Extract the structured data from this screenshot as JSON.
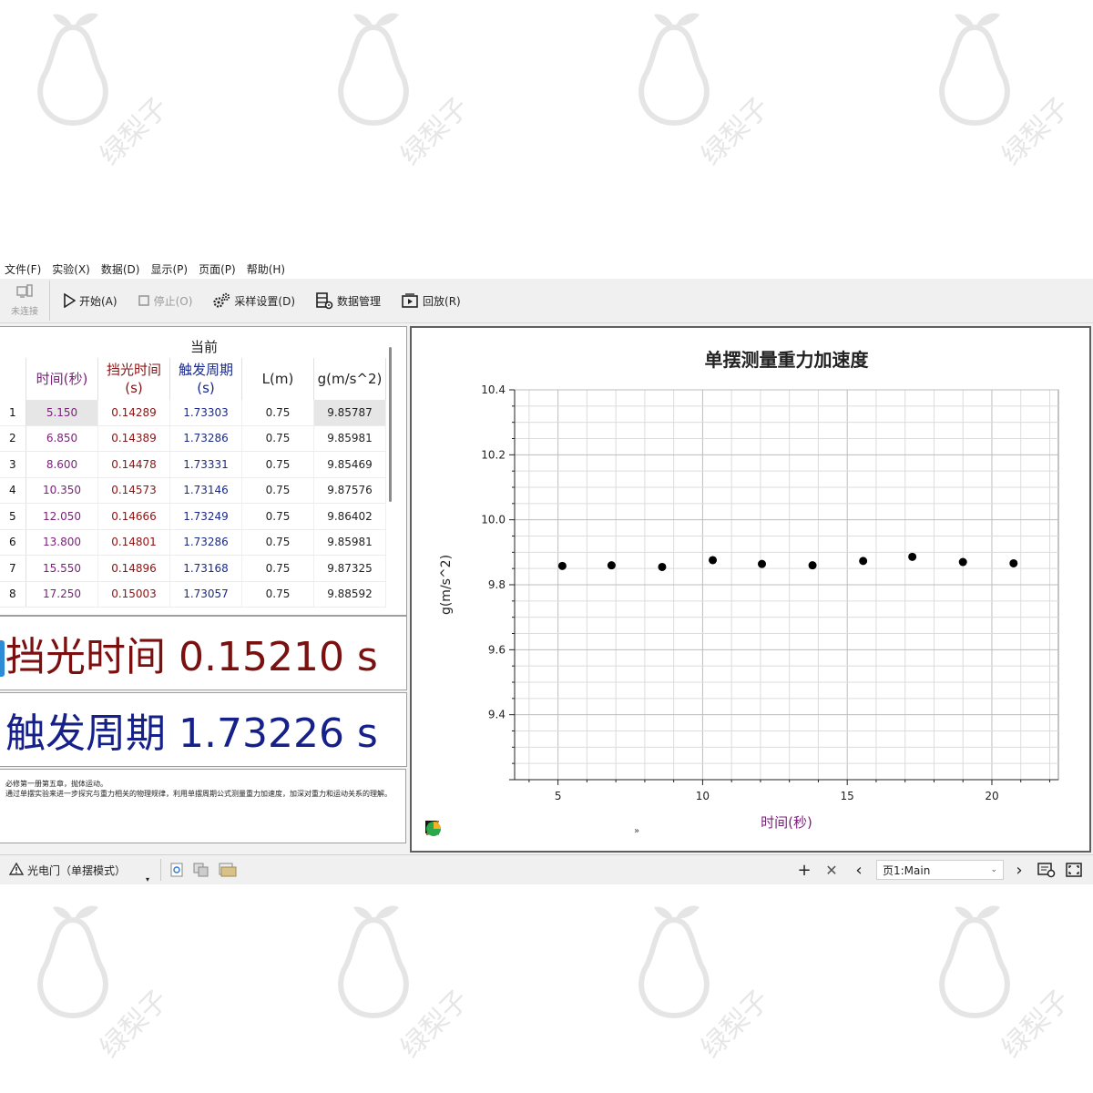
{
  "menu": [
    "文件(F)",
    "实验(X)",
    "数据(D)",
    "显示(P)",
    "页面(P)",
    "帮助(H)"
  ],
  "toolbar": {
    "connection_label": "未连接",
    "start_label": "开始(A)",
    "stop_label": "停止(O)",
    "sampling_label": "采样设置(D)",
    "data_mgmt_label": "数据管理",
    "playback_label": "回放(R)"
  },
  "table": {
    "group_header": "当前",
    "columns": [
      {
        "line1": "时间(秒)",
        "line2": ""
      },
      {
        "line1": "挡光时间",
        "line2": "(s)"
      },
      {
        "line1": "触发周期",
        "line2": "(s)"
      },
      {
        "line1": "L(m)",
        "line2": ""
      },
      {
        "line1": "g(m/s^2)",
        "line2": ""
      }
    ],
    "rows": [
      {
        "n": "1",
        "time": "5.150",
        "block": "0.14289",
        "period": "1.73303",
        "len": "0.75",
        "g": "9.85787"
      },
      {
        "n": "2",
        "time": "6.850",
        "block": "0.14389",
        "period": "1.73286",
        "len": "0.75",
        "g": "9.85981"
      },
      {
        "n": "3",
        "time": "8.600",
        "block": "0.14478",
        "period": "1.73331",
        "len": "0.75",
        "g": "9.85469"
      },
      {
        "n": "4",
        "time": "10.350",
        "block": "0.14573",
        "period": "1.73146",
        "len": "0.75",
        "g": "9.87576"
      },
      {
        "n": "5",
        "time": "12.050",
        "block": "0.14666",
        "period": "1.73249",
        "len": "0.75",
        "g": "9.86402"
      },
      {
        "n": "6",
        "time": "13.800",
        "block": "0.14801",
        "period": "1.73286",
        "len": "0.75",
        "g": "9.85981"
      },
      {
        "n": "7",
        "time": "15.550",
        "block": "0.14896",
        "period": "1.73168",
        "len": "0.75",
        "g": "9.87325"
      },
      {
        "n": "8",
        "time": "17.250",
        "block": "0.15003",
        "period": "1.73057",
        "len": "0.75",
        "g": "9.88592"
      }
    ]
  },
  "big_display_1": "挡光时间 0.15210 s",
  "big_display_2": "触发周期 1.73226 s",
  "note": {
    "line1": "必修第一册第五章，抛体运动。",
    "line2": "通过单摆实验来进一步探究与重力相关的物理规律，利用单摆周期公式测量重力加速度，加深对重力和运动关系的理解。"
  },
  "chart_data": {
    "type": "scatter",
    "title": "单摆测量重力加速度",
    "xlabel": "时间(秒)",
    "ylabel": "g(m/s^2)",
    "xlim": [
      3.5,
      22.3
    ],
    "ylim": [
      9.2,
      10.4
    ],
    "xticks": [
      5,
      10,
      15,
      20
    ],
    "yticks": [
      9.4,
      9.6,
      9.8,
      10.0,
      10.2,
      10.4
    ],
    "grid": true,
    "series": [
      {
        "x": [
          5.15,
          6.85,
          8.6,
          10.35,
          12.05,
          13.8,
          15.55,
          17.25,
          19.0,
          20.75
        ],
        "y": [
          9.85787,
          9.85981,
          9.85469,
          9.87576,
          9.86402,
          9.85981,
          9.87325,
          9.88592,
          9.87,
          9.866
        ]
      }
    ]
  },
  "status": {
    "sensor_label": "光电门（单摆模式）",
    "page_label": "页1:Main"
  },
  "watermark": "绿梨子",
  "colors": {
    "time": "#7a1f7a",
    "block": "#8a1414",
    "period": "#1a2a8a",
    "xlabel": "#7a1f7a"
  }
}
